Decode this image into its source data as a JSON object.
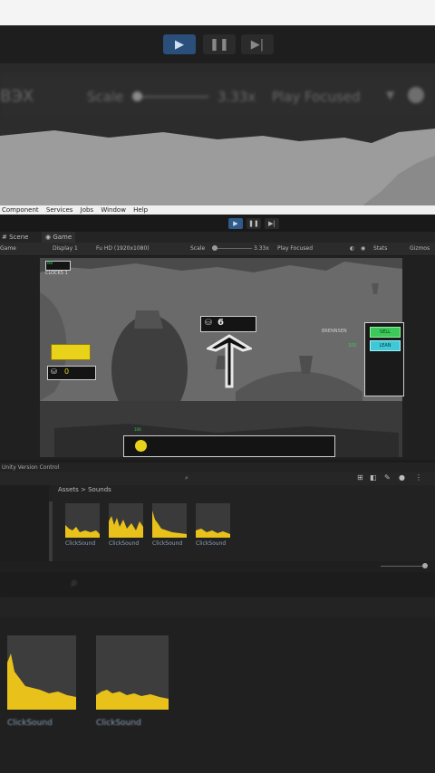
{
  "toolbar": {
    "play_icon": "play-icon",
    "pause_icon": "pause-icon",
    "step_icon": "step-icon",
    "accent": "#2f73c0"
  },
  "zoom_top": {
    "left_text": "ВЭХ",
    "scale_label": "Scale",
    "scale_value": "3.33x",
    "play_focused": "Play Focused"
  },
  "menu": {
    "items": [
      "Component",
      "Services",
      "Jobs",
      "Window",
      "Help"
    ]
  },
  "tabs": {
    "scene": "Scene",
    "game": "Game"
  },
  "game_bar": {
    "display_dropdown": "Game",
    "display": "Display 1",
    "resolution": "Fu HD (1920x1080)",
    "scale_label": "Scale",
    "scale_value": "3.33x",
    "play_focused": "Play Focused",
    "gizmos": "Gizmos"
  },
  "game": {
    "top_left_badge": "88",
    "top_left_label": "CLOCKS 1",
    "pickaxe_count": "6",
    "gold_count": "0",
    "resources_label": "BRENNSEN",
    "resources_value": "100",
    "right_btn_1": "SELL",
    "right_btn_2": "LEAN",
    "bottom_label": "100",
    "colors": {
      "gold": "#e8d21a",
      "green": "#3cc95a",
      "cyan": "#3ec8d8",
      "sky": "#9a9a9a"
    }
  },
  "vcs": {
    "label": "Unity Version Control"
  },
  "project": {
    "breadcrumb": "Assets > Sounds",
    "search_placeholder": "",
    "assets": [
      {
        "name": "ClickSound"
      },
      {
        "name": "ClickSound"
      },
      {
        "name": "ClickSound"
      },
      {
        "name": "ClickSound"
      }
    ]
  },
  "zoom_bottom": {
    "assets": [
      {
        "name": "ClickSound"
      },
      {
        "name": "ClickSound"
      }
    ]
  }
}
